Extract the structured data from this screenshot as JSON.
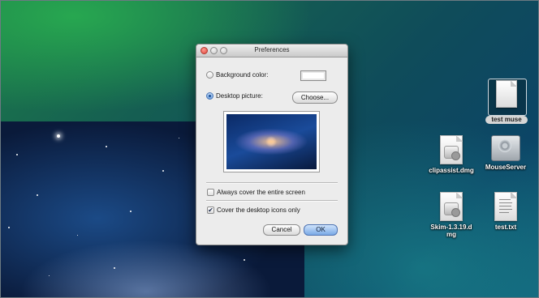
{
  "dialog": {
    "title": "Preferences",
    "background_color_label": "Background color:",
    "desktop_picture_label": "Desktop picture:",
    "choose_button": "Choose...",
    "always_cover_label": "Always cover the entire screen",
    "cover_icons_label": "Cover the desktop icons only",
    "cancel_button": "Cancel",
    "ok_button": "OK",
    "background_color_selected": false,
    "desktop_picture_selected": true,
    "always_cover_checked": false,
    "cover_icons_checked": true
  },
  "desktop_icons": [
    {
      "label": "test muse",
      "icon": "document-icon",
      "selected": true
    },
    {
      "label": "clipassist.dmg",
      "icon": "disk-image-icon"
    },
    {
      "label": "MouseServer",
      "icon": "server-app-icon"
    },
    {
      "label": "Skim-1.3.19.dmg",
      "icon": "disk-image-icon"
    },
    {
      "label": "test.txt",
      "icon": "text-file-icon"
    }
  ]
}
